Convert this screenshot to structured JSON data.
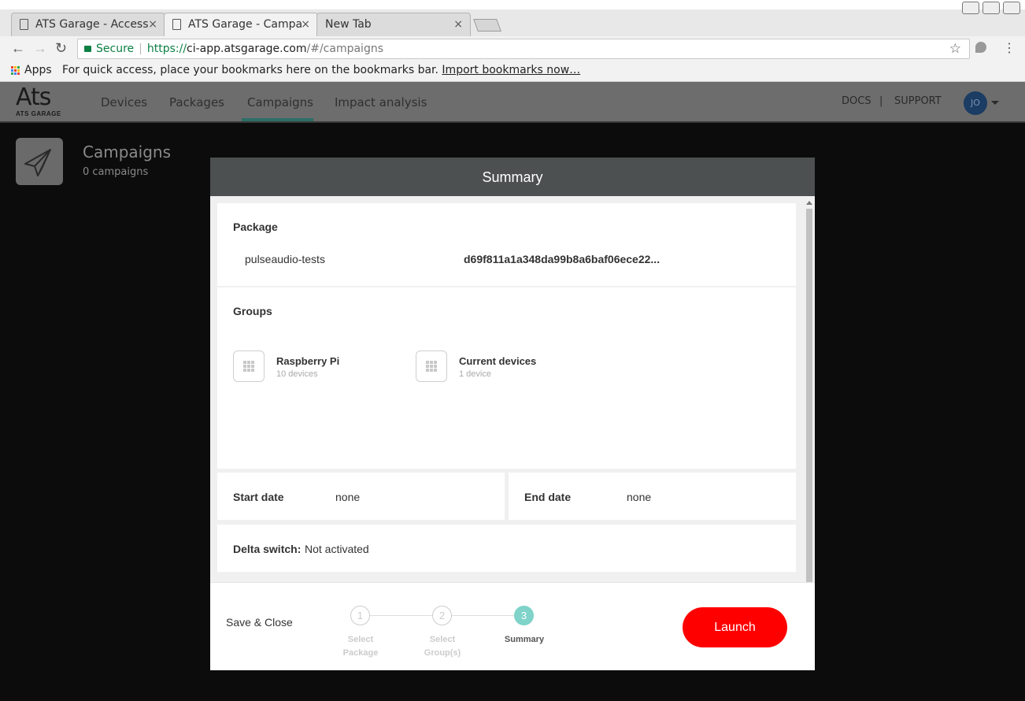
{
  "browser": {
    "tabs": [
      {
        "title": "ATS Garage - Access",
        "close": "×"
      },
      {
        "title": "ATS Garage - Campa",
        "close": "×"
      },
      {
        "title": "New Tab",
        "close": "×"
      }
    ],
    "url": {
      "secure_label": "Secure",
      "scheme": "https://",
      "host": "ci-app.atsgarage.com",
      "path": "/#/campaigns"
    },
    "bookmarks": {
      "apps_label": "Apps",
      "hint": "For quick access, place your bookmarks here on the bookmarks bar.",
      "import_link": "Import bookmarks now…"
    }
  },
  "app": {
    "logo_main": "Ats",
    "logo_sub": "ATS GARAGE",
    "nav": [
      "Devices",
      "Packages",
      "Campaigns",
      "Impact analysis"
    ],
    "active_nav": "Campaigns",
    "links": {
      "docs": "DOCS",
      "divider": "|",
      "support": "SUPPORT"
    },
    "avatar_initials": "JO"
  },
  "page": {
    "title": "Campaigns",
    "count": "0 campaigns"
  },
  "modal": {
    "title": "Summary",
    "package": {
      "heading": "Package",
      "name": "pulseaudio-tests",
      "hash": "d69f811a1a348da99b8a6baf06ece22..."
    },
    "groups": {
      "heading": "Groups",
      "items": [
        {
          "name": "Raspberry Pi",
          "count": "10 devices"
        },
        {
          "name": "Current devices",
          "count": "1 device"
        }
      ]
    },
    "start_date": {
      "label": "Start date",
      "value": "none"
    },
    "end_date": {
      "label": "End date",
      "value": "none"
    },
    "delta": {
      "label": "Delta switch:",
      "value": "Not activated"
    },
    "footer": {
      "save_close": "Save & Close",
      "steps": [
        {
          "number": "1",
          "label": "Select Package",
          "active": false
        },
        {
          "number": "2",
          "label": "Select Group(s)",
          "active": false
        },
        {
          "number": "3",
          "label": "Summary",
          "active": true
        }
      ],
      "launch": "Launch"
    }
  },
  "colors": {
    "accent": "#7fd3c9",
    "launch": "#ff0000",
    "modal_header": "#4d5051",
    "avatar": "#1b3c63"
  }
}
